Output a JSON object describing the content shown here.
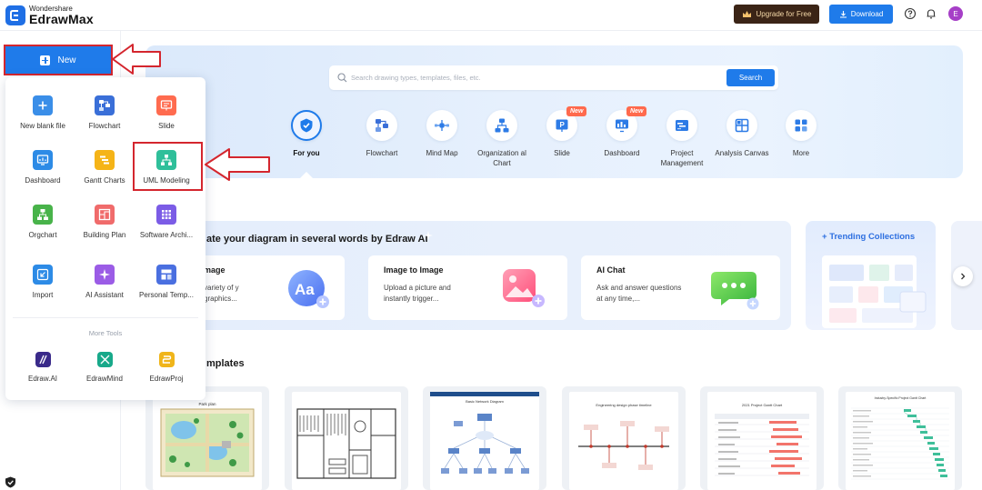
{
  "header": {
    "brand_top": "Wondershare",
    "brand_main": "EdrawMax",
    "upgrade_label": "Upgrade for Free",
    "download_label": "Download",
    "avatar_initial": "E",
    "icons": [
      "crown-icon",
      "download-icon",
      "help-icon",
      "bell-icon"
    ]
  },
  "new_button": {
    "label": "New"
  },
  "new_menu": {
    "items": [
      {
        "label": "New blank file",
        "icon": "plus-icon",
        "color": "#3a8ee8"
      },
      {
        "label": "Flowchart",
        "icon": "flowchart-icon",
        "color": "#3a6fd8"
      },
      {
        "label": "Slide",
        "icon": "slide-icon",
        "color": "#ff6b4f"
      },
      {
        "label": "Dashboard",
        "icon": "dashboard-icon",
        "color": "#2d8be6"
      },
      {
        "label": "Gantt Charts",
        "icon": "gantt-icon",
        "color": "#f5b418"
      },
      {
        "label": "UML Modeling",
        "icon": "uml-icon",
        "color": "#2fbf9a"
      },
      {
        "label": "Orgchart",
        "icon": "orgchart-icon",
        "color": "#48b34a"
      },
      {
        "label": "Building Plan",
        "icon": "building-plan-icon",
        "color": "#f06b6b"
      },
      {
        "label": "Software Archi...",
        "icon": "software-architecture-icon",
        "color": "#7b5ce6"
      },
      {
        "label": "Import",
        "icon": "import-icon",
        "color": "#2d8be6"
      },
      {
        "label": "AI Assistant",
        "icon": "ai-assistant-icon",
        "color": "#9b5ce6"
      },
      {
        "label": "Personal Temp...",
        "icon": "personal-templates-icon",
        "color": "#4a6fe0"
      }
    ],
    "more_tools_label": "More Tools",
    "tools": [
      {
        "label": "Edraw.AI",
        "icon": "edraw-ai-icon",
        "color": "#3a2a8a"
      },
      {
        "label": "EdrawMind",
        "icon": "edrawmind-icon",
        "color": "#18a98a"
      },
      {
        "label": "EdrawProj",
        "icon": "edrawproj-icon",
        "color": "#f0b51a"
      }
    ]
  },
  "search": {
    "placeholder": "Search drawing types, templates, files, etc.",
    "button_label": "Search"
  },
  "categories": [
    {
      "label": "For you",
      "icon": "for-you-icon",
      "active": true
    },
    {
      "label": "Flowchart",
      "icon": "flowchart-icon"
    },
    {
      "label": "Mind Map",
      "icon": "mind-map-icon"
    },
    {
      "label": "Organization al Chart",
      "icon": "organizational-chart-icon"
    },
    {
      "label": "Slide",
      "icon": "slide-icon",
      "badge": "New"
    },
    {
      "label": "Dashboard",
      "icon": "dashboard-icon",
      "badge": "New"
    },
    {
      "label": "Project Management",
      "icon": "project-management-icon"
    },
    {
      "label": "Analysis Canvas",
      "icon": "analysis-canvas-icon"
    },
    {
      "label": "More",
      "icon": "more-icon"
    }
  ],
  "ai_section": {
    "heading": "ate your diagram in several words by Edraw AI",
    "cards": [
      {
        "title": "mage",
        "description": "variety of y graphics..."
      },
      {
        "title": "Image to Image",
        "description": "Upload a picture and instantly trigger..."
      },
      {
        "title": "AI Chat",
        "description": "Ask and answer questions at any time,..."
      }
    ]
  },
  "trending": {
    "title": "Trending Collections"
  },
  "templates": {
    "heading": "mplates",
    "cards": [
      {
        "caption": "Park plan"
      },
      {
        "caption": ""
      },
      {
        "caption": "Basic Network Diagram"
      },
      {
        "caption": "Engineering design phase timeline"
      },
      {
        "caption": "2021 Project Gantt Chart"
      },
      {
        "caption": "Industry-Specific Project Gantt Chart"
      }
    ]
  },
  "colors": {
    "accent": "#1f7bea",
    "callout": "#d4262e",
    "upgrade_bg": "#3b2416"
  }
}
